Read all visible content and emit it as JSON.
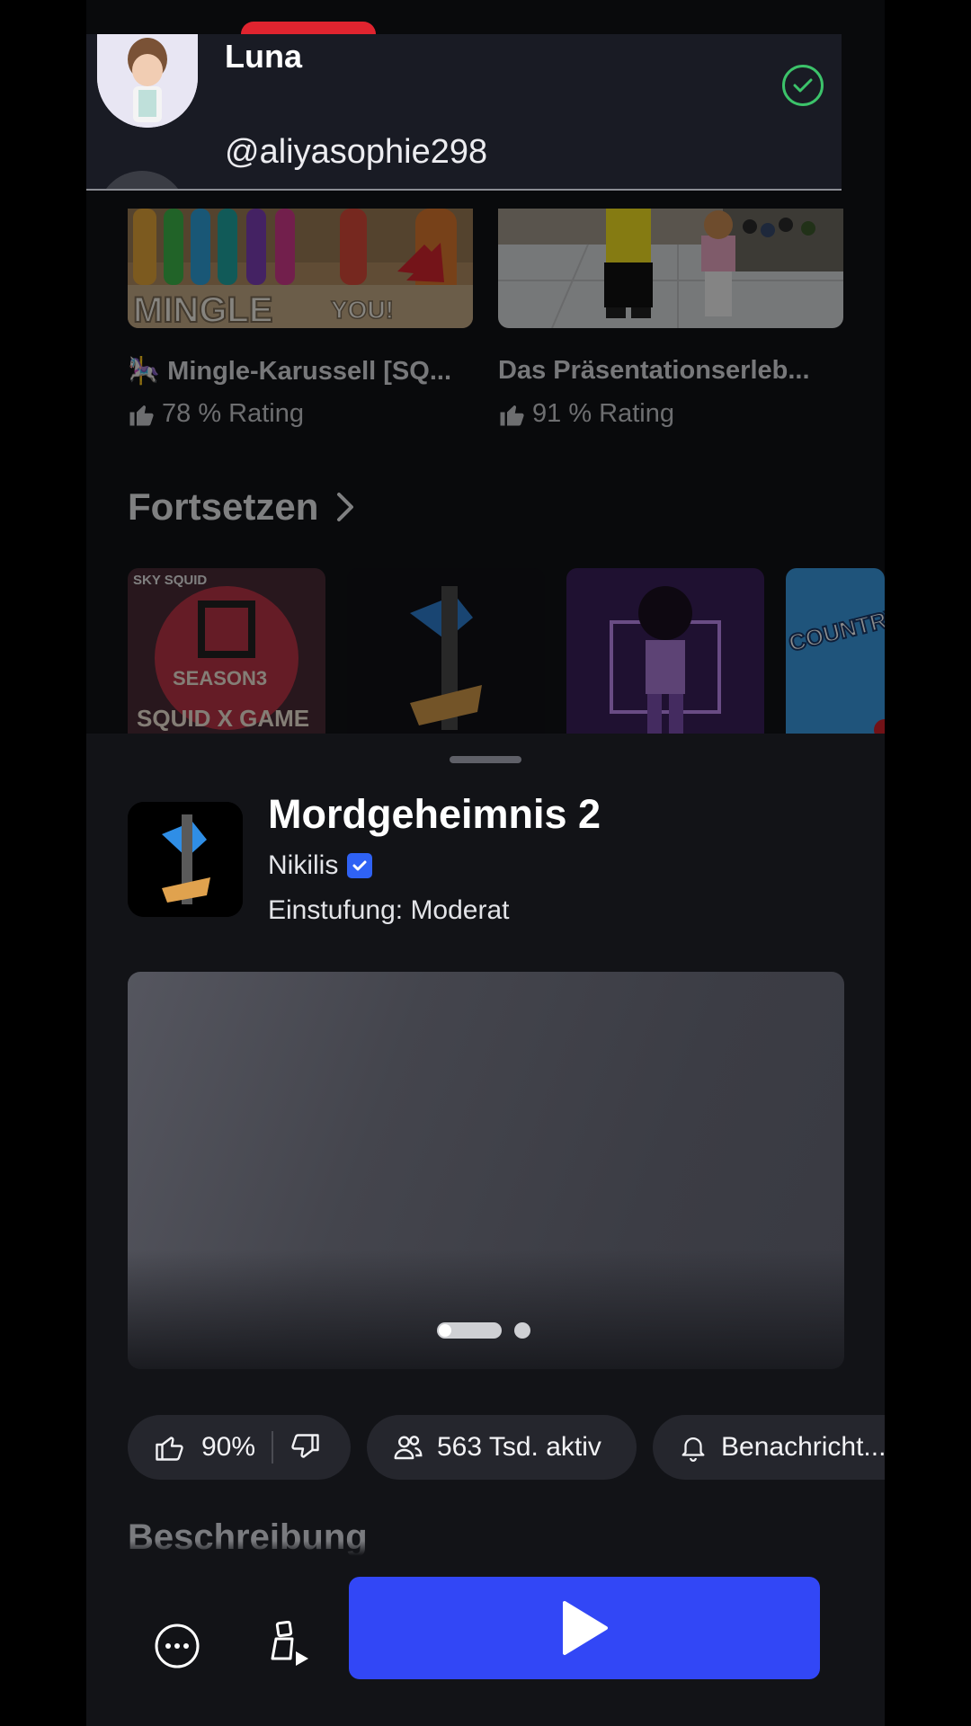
{
  "account_banner": {
    "name": "Luna",
    "handle": "@aliyasophie298"
  },
  "recommended_games": [
    {
      "title": "🎠 Mingle-Karussell [SQ...",
      "rating": "78 % Rating",
      "thumb_text_1": "MINGLE",
      "thumb_text_2": "YOU!"
    },
    {
      "title": "Das Präsentationserleb...",
      "rating": "91 % Rating"
    }
  ],
  "continue_section": {
    "title": "Fortsetzen",
    "tiles": [
      {
        "label_top": "SKY SQUID",
        "label_mid": "SEASON3",
        "label_bottom": "SQUID X GAME"
      },
      {
        "label": ""
      },
      {
        "label": ""
      },
      {
        "label": "COUNTRY NEIGHBO"
      }
    ]
  },
  "game_sheet": {
    "title": "Mordgeheimnis 2",
    "developer": "Nikilis",
    "age_rating": "Einstufung: Moderat",
    "media_pages": 2,
    "media_active_page": 1,
    "like_percent": "90%",
    "active_players": "563 Tsd. aktiv",
    "notify_label": "Benachricht...",
    "description_title": "Beschreibung"
  },
  "colors": {
    "play_button": "#3247f6",
    "verified_badge": "#2f62f4",
    "check_green": "#3cc36a",
    "sheet_bg": "#121317"
  },
  "icons": [
    "check-circle-icon",
    "thumbs-up-icon",
    "thumbs-down-icon",
    "users-icon",
    "bell-icon",
    "more-icon",
    "avatar-pose-icon",
    "play-icon",
    "chevron-right-icon"
  ]
}
